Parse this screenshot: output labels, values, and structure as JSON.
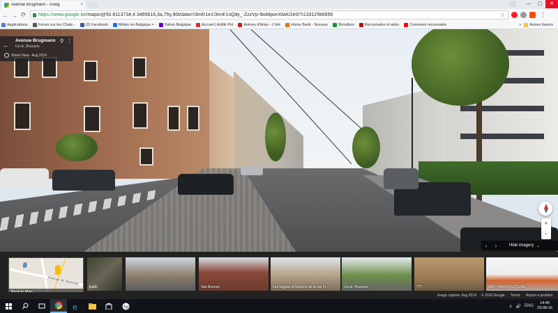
{
  "browser": {
    "tab_title": "Avenue Brugmann - Goog",
    "tab_close": "×",
    "url_host": "https://www.google.be",
    "url_path": "/maps/@50.8113734,4.3465616,3a,75y,90t/data=!3m6!1e1!3m4!1sQdy_-ZzzVp-9ioMponXblA!2e0!7i13312!8i6656",
    "window_controls": [
      "—",
      "▢",
      "✕"
    ],
    "nav": {
      "back": "←",
      "forward": "→",
      "reload": "⟳"
    },
    "star_icon": "☆",
    "menu_icon": "⋮"
  },
  "bookmarks": {
    "items": [
      {
        "label": "Applications",
        "color": "#4a7fd6"
      },
      {
        "label": "Forum sur les Chats -",
        "color": "#555555"
      },
      {
        "label": "(2) Facebook",
        "color": "#3b5998"
      },
      {
        "label": "Météo en Belgique =",
        "color": "#1a73e8"
      },
      {
        "label": "Yahoo Belgique",
        "color": "#5f01d1"
      },
      {
        "label": "Accueil | Addik Pet",
        "color": "#d93025"
      },
      {
        "label": "Arènes d'Arles - L'His",
        "color": "#c5221f"
      },
      {
        "label": "Home Bank - Nouvea",
        "color": "#e37400"
      },
      {
        "label": "Shoutbox",
        "color": "#1e8e3e"
      },
      {
        "label": "Reconnaitre et aider",
        "color": "#b31412"
      },
      {
        "label": "Comment reconnaitre",
        "color": "#ff0000"
      }
    ],
    "more": "»",
    "other": "Autres favoris"
  },
  "streetview": {
    "title": "Avenue Brugmann",
    "subtitle": "Uccle, Brussels",
    "history": "Street View - Aug 2014",
    "back_icon": "←",
    "pin_icon": "⚲",
    "more_icon": "⋮",
    "zoom_in": "+",
    "zoom_out": "−"
  },
  "filmstrip": {
    "prev": "‹",
    "next": "›",
    "hide_label": "Hide imagery",
    "hide_chevron": "⌄",
    "minimap_road": "Avenue de Messidor",
    "back_to_map": "Back to Map",
    "earth_label": "Earth",
    "thumbs": [
      {
        "label": "",
        "bg": "linear-gradient(#cfd6dd,#8b7f6e 55%,#5c5c5c)"
      },
      {
        "label": "Van Bunnen",
        "bg": "linear-gradient(#d7dde4,#8a4a3a 45%,#6b3a2e)"
      },
      {
        "label": "Les loggias et balcons de la rue Fr...",
        "bg": "linear-gradient(#dfe4ea,#b8a78c 50%,#7d6e5b)"
      },
      {
        "label": "Uccle, Brussels",
        "bg": "linear-gradient(#e4e9ee,#6d8f4a 55%,#666)"
      },
      {
        "label": "???",
        "bg": "linear-gradient(#b99b6f,#9d7b55 60%,#6b5a45)"
      },
      {
        "label": "ARC / ARCHITECTURE",
        "bg": "linear-gradient(#f4f4f4,#eeeeee 50%,#d7622e 70%,#a7a7a7)"
      }
    ]
  },
  "footer": {
    "capture": "Image capture: Aug 2014",
    "copyright": "© 2016 Google",
    "terms": "Terms",
    "report": "Report a problem"
  },
  "taskbar": {
    "time": "14:45",
    "date": "23-08-16",
    "tray": [
      "∧",
      "🔊",
      "ENG"
    ]
  }
}
